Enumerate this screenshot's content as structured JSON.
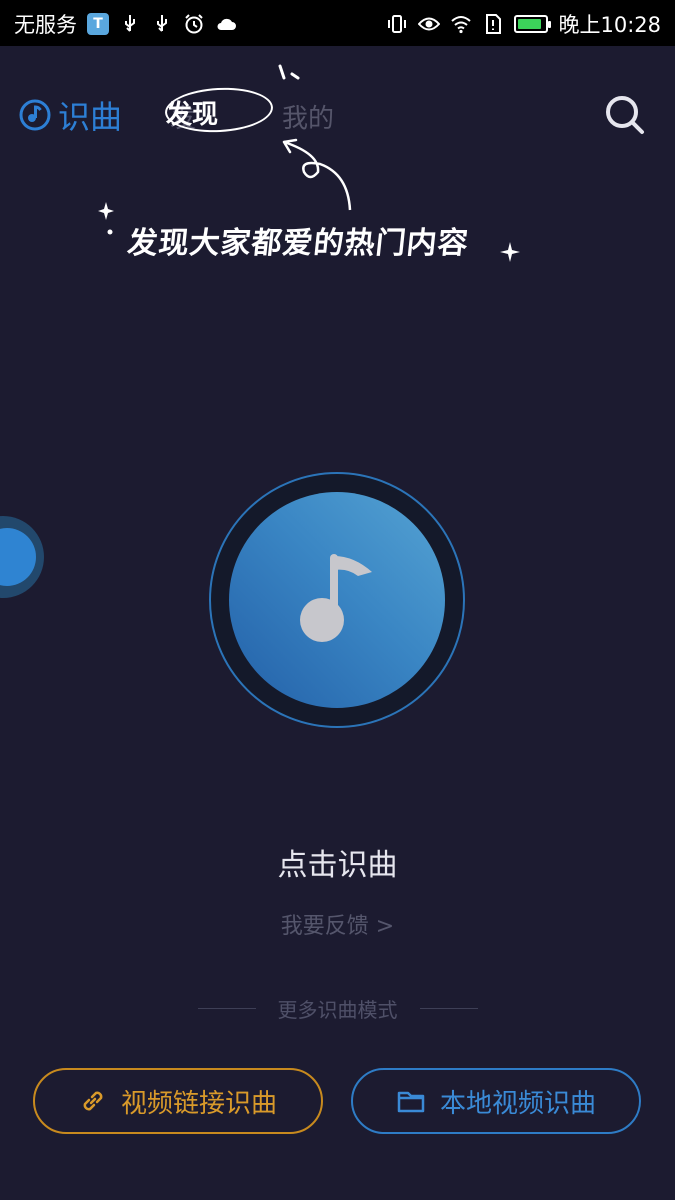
{
  "status_bar": {
    "carrier": "无服务",
    "badge": "T",
    "time": "晚上10:28",
    "battery_level": 0.85,
    "icons": [
      "usb-icon",
      "usb-icon",
      "alarm-icon",
      "cloud-icon",
      "vibrate-icon",
      "eye-icon",
      "wifi-icon",
      "sim-alert-icon",
      "battery-icon"
    ]
  },
  "header": {
    "logo_text": "识曲",
    "tab_discover": "发现",
    "tab_discover_bg": "发",
    "tab_mine": "我的"
  },
  "tip": {
    "text": "发现大家都爱的热门内容"
  },
  "main": {
    "recognize_label": "点击识曲",
    "feedback_label": "我要反馈 >",
    "more_modes_label": "更多识曲模式"
  },
  "buttons": {
    "video_link": "视频链接识曲",
    "local_video": "本地视频识曲"
  },
  "colors": {
    "background": "#1c1b30",
    "accent_blue": "#2d7fd5",
    "accent_orange": "#d99a2a"
  }
}
